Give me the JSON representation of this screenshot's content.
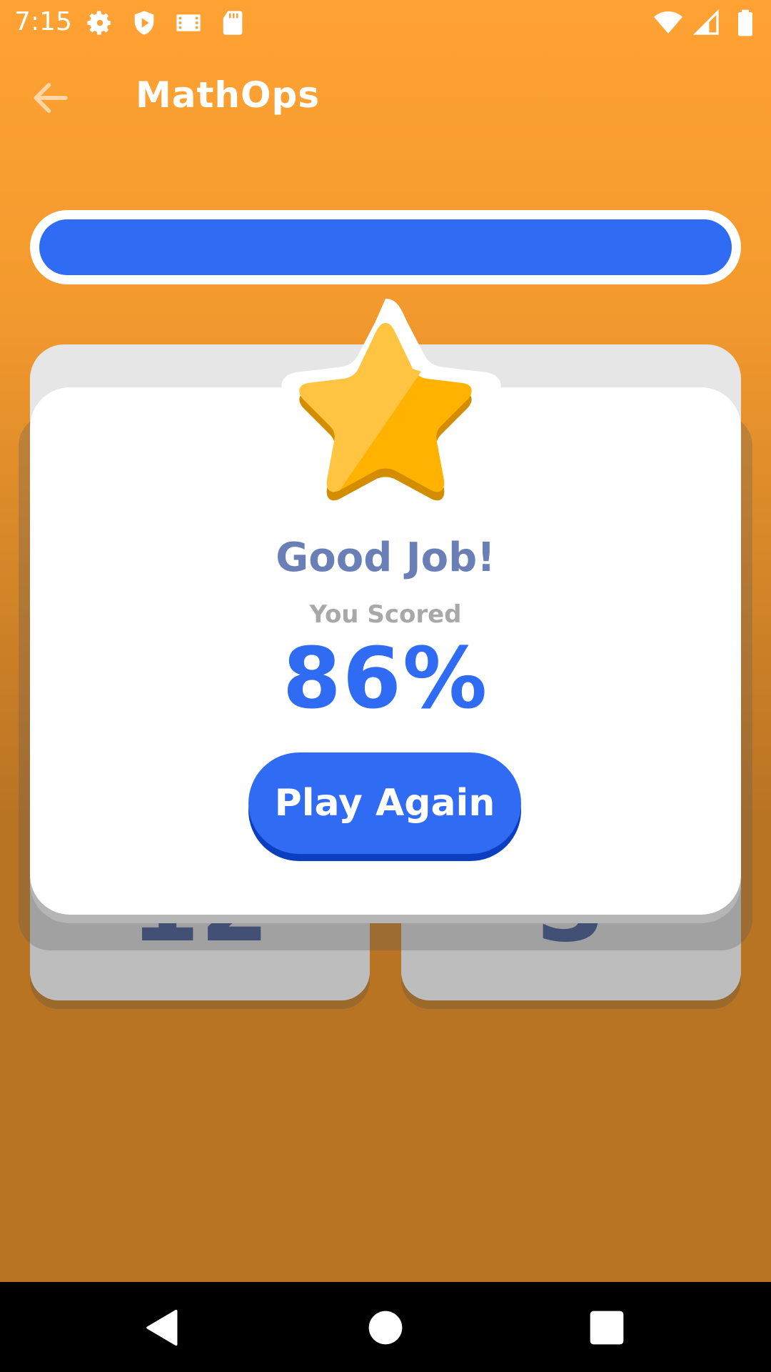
{
  "status_bar": {
    "time": "7:15",
    "left_icons": [
      "gear-icon",
      "shield-icon",
      "film-icon",
      "sd-card-icon"
    ],
    "right_icons": [
      "wifi-icon",
      "cell-signal-icon",
      "battery-icon"
    ]
  },
  "app_bar": {
    "title": "MathOps",
    "back_icon": "arrow-left-icon"
  },
  "progress": {
    "fraction": 1.0,
    "color": "#306bf3"
  },
  "answer_tiles": [
    {
      "value": "12"
    },
    {
      "value": "3"
    }
  ],
  "result_dialog": {
    "icon": "star-icon",
    "heading": "Good Job!",
    "subheading": "You Scored",
    "score": "86%",
    "button_label": "Play Again"
  },
  "colors": {
    "background_top": "#ffa233",
    "background_bottom": "#b87323",
    "accent": "#306bf3",
    "heading": "#6a7fb6",
    "star": "#ffb300"
  },
  "nav_bar": {
    "buttons": [
      "back-triangle-icon",
      "home-circle-icon",
      "recents-square-icon"
    ]
  }
}
